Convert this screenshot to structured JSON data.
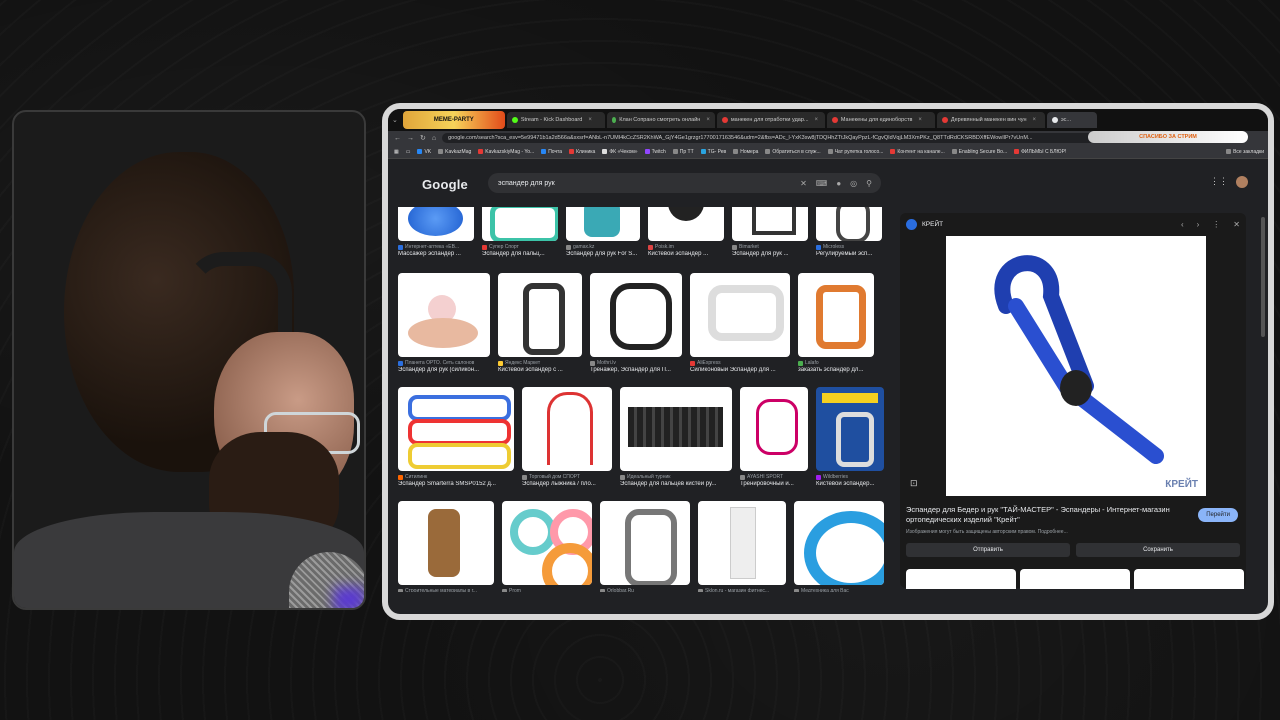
{
  "tabs": [
    {
      "label": "MEME-PARTY",
      "stream": true
    },
    {
      "label": "Stream - Kick Dashboard",
      "color": "#53fc18"
    },
    {
      "label": "Клан Сопрано смотреть онлайн",
      "color": "#4caf50"
    },
    {
      "label": "манекен для отработки удар...",
      "color": "#e53935"
    },
    {
      "label": "Манекены для единоборств",
      "color": "#e53935"
    },
    {
      "label": "Деревянный манекен вин чун",
      "color": "#e53935"
    },
    {
      "label": "эс...",
      "color": "#e8eaed"
    }
  ],
  "alert_text": "СПАСИБО ЗА СТРИМ",
  "url": "google.com/search?sca_esv=5e99471b1a2d566a&sxsrf=ANbL-n7UMI4kCcZSR2KhWA_GjY4Ge1grzgr1770017163546&udm=2&fbs=ADc_l-YxK3sw8jTDQHhZTtJkQayPpzL-fCgvQIdVqjLM3XmPKz_Q8TTdRdCKSRBDXffEWowIlPr7vUnM...",
  "bookmarks": [
    {
      "label": "VK",
      "color": "#2787f5"
    },
    {
      "label": "KavkazMag",
      "color": "#888"
    },
    {
      "label": "KavkazskiyMag - Yo...",
      "color": "#e53935"
    },
    {
      "label": "Почта",
      "color": "#2787f5"
    },
    {
      "label": "Клиника",
      "color": "#e53935"
    },
    {
      "label": "ФК «Чеком»",
      "color": "#ddd"
    },
    {
      "label": "Twitch",
      "color": "#9146ff"
    },
    {
      "label": "Пр ТТ",
      "color": "#888"
    },
    {
      "label": "TG- Рев",
      "color": "#2aa4e0"
    },
    {
      "label": "Номера",
      "color": "#888"
    },
    {
      "label": "Обратиться в служ...",
      "color": "#888"
    },
    {
      "label": "Чат рулетка голосо...",
      "color": "#888"
    },
    {
      "label": "Контент на канале...",
      "color": "#e53935"
    },
    {
      "label": "Enabling Secure Bo...",
      "color": "#888"
    },
    {
      "label": "ФИЛЬМЫ С БЛЮР!",
      "color": "#e53935"
    },
    {
      "label": "Все закладки",
      "color": "#888"
    }
  ],
  "google_logo": "Google",
  "search_query": "эспандер для рук",
  "results": [
    [
      {
        "src": "Интернет-аптека «ЕВ...",
        "title": "Массажер эспандер ...",
        "color": "#2b6fdf"
      },
      {
        "src": "Супер Спорт",
        "title": "Эспандер для пальц...",
        "color": "#3cc3a8"
      },
      {
        "src": "gamax.kz",
        "title": "Эспандер для рук For S...",
        "color": "#3aa9b5"
      },
      {
        "src": "Poisk.im",
        "title": "Кистевой эспандер ...",
        "color": "#222"
      },
      {
        "src": "Bimarket",
        "title": "Эспандер для рук ...",
        "color": "#333"
      },
      {
        "src": "Microless",
        "title": "Регулируемый эсп...",
        "color": "#444"
      }
    ],
    [
      {
        "src": "Планета ОРТО. Сеть салонов",
        "title": "Эспандер для рук (силикон...",
        "color": "#f4c4c4"
      },
      {
        "src": "Яндекс Маркет",
        "title": "Кистевой эспандер с ...",
        "color": "#333"
      },
      {
        "src": "Mothri.lv",
        "title": "Тренажер, Эспандер для П...",
        "color": "#222"
      },
      {
        "src": "AliExpress",
        "title": "Силиконовый Эспандер для ...",
        "color": "#ddd"
      },
      {
        "src": "Lalafo",
        "title": "заказать эспандер дл...",
        "color": "#e07a30"
      }
    ],
    [
      {
        "src": "Ситилинк",
        "title": "Эспандер Smarterra SMSP0152 д...",
        "color": "#3b6fdf"
      },
      {
        "src": "Торговый дом СПОРТ",
        "title": "Эспандер лыжника / пло...",
        "color": "#d33"
      },
      {
        "src": "Идеальный турник",
        "title": "Эспандер для пальцев кистей ру...",
        "color": "#222"
      },
      {
        "src": "AYASHI SPORT",
        "title": "Тренировочный и...",
        "color": "#c06"
      },
      {
        "src": "Wildberries",
        "title": "Кистевой эспандер...",
        "color": "#1f4fa0"
      }
    ],
    [
      {
        "src": "Строительные материалы в г...",
        "title": "",
        "color": "#9a6a3a"
      },
      {
        "src": "Prom",
        "title": "",
        "color": "#f59b3a"
      },
      {
        "src": "Orlobbar.Ru",
        "title": "",
        "color": "#777"
      },
      {
        "src": "Sklon.ru - магазин фитнес...",
        "title": "",
        "color": "#c8a0d8"
      },
      {
        "src": "Медтехника для Вас",
        "title": "",
        "color": "#2a9ee0"
      }
    ]
  ],
  "preview": {
    "site": "КРЕЙТ",
    "watermark": "КРЕЙТ",
    "title": "Эспандер для Бедер и рук \"ТАЙ-МАСТЕР\" - Эспандеры - Интернет-магазин ортопедических изделий \"Крейт\"",
    "note": "Изображения могут быть защищены авторским правом. Подробнее...",
    "visit": "Перейти",
    "share": "Отправить",
    "save": "Сохранить"
  }
}
